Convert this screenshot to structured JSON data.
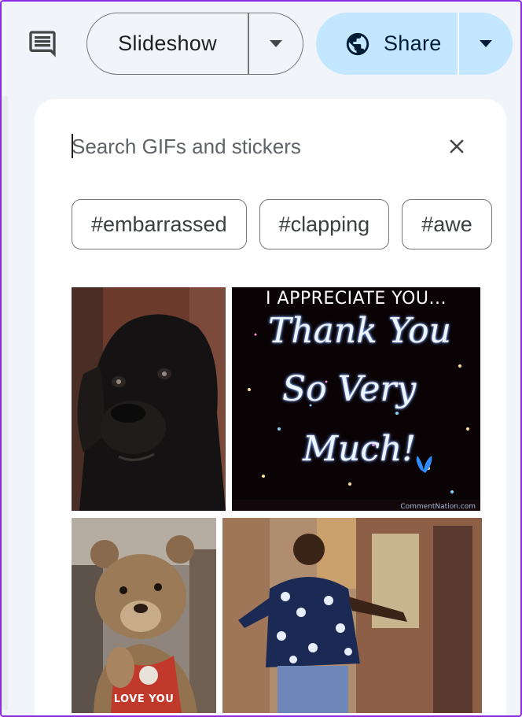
{
  "toolbar": {
    "comment_icon": "comment-icon",
    "slideshow_label": "Slideshow",
    "share_label": "Share",
    "share_icon": "globe-icon",
    "accent": "#c2e7ff",
    "frame_color": "#8a2be2"
  },
  "gif_panel": {
    "search": {
      "placeholder": "Search GIFs and stickers",
      "value": ""
    },
    "close_icon": "close-icon",
    "chips": [
      "#embarrassed",
      "#clapping",
      "#awe"
    ],
    "gifs": [
      {
        "name": "dog-gif",
        "text": ""
      },
      {
        "name": "thank-you-gif",
        "title": "I APPRECIATE YOU...",
        "script_lines": [
          "Thank You",
          "So Very",
          "Much!"
        ],
        "watermark": "CommentNation.com"
      },
      {
        "name": "teddy-bear-gif",
        "caption": "LOVE YOU"
      },
      {
        "name": "dancing-gif",
        "text": ""
      }
    ]
  }
}
